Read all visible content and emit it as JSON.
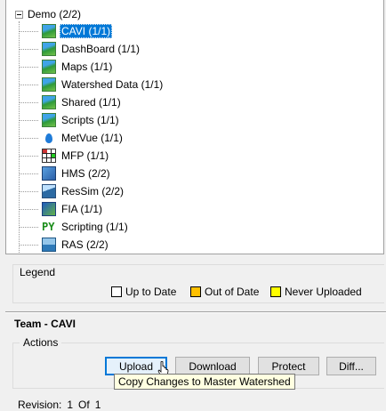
{
  "tree": {
    "root_label": "Demo (2/2)",
    "items": [
      {
        "label": "CAVI (1/1)",
        "icon": "globe-icon",
        "selected": true
      },
      {
        "label": "DashBoard (1/1)",
        "icon": "globe-icon"
      },
      {
        "label": "Maps (1/1)",
        "icon": "globe-icon"
      },
      {
        "label": "Watershed Data (1/1)",
        "icon": "globe-icon"
      },
      {
        "label": "Shared (1/1)",
        "icon": "globe-icon"
      },
      {
        "label": "Scripts (1/1)",
        "icon": "globe-icon"
      },
      {
        "label": "MetVue (1/1)",
        "icon": "water-drop-icon"
      },
      {
        "label": "MFP (1/1)",
        "icon": "grid-icon"
      },
      {
        "label": "HMS (2/2)",
        "icon": "hms-icon"
      },
      {
        "label": "ResSim (2/2)",
        "icon": "ressim-icon"
      },
      {
        "label": "FIA (1/1)",
        "icon": "fia-icon"
      },
      {
        "label": "Scripting (1/1)",
        "icon": "py-icon",
        "glyph": "PY"
      },
      {
        "label": "RAS (2/2)",
        "icon": "ras-icon"
      }
    ]
  },
  "legend": {
    "title": "Legend",
    "entries": [
      {
        "label": "Up to Date",
        "color": "#ffffff"
      },
      {
        "label": "Out of Date",
        "color": "#ffc000"
      },
      {
        "label": "Never Uploaded",
        "color": "#ffff00"
      }
    ]
  },
  "team": {
    "title": "Team - CAVI",
    "actions_title": "Actions",
    "buttons": {
      "upload": "Upload",
      "download": "Download",
      "protect": "Protect",
      "diff": "Diff..."
    },
    "tooltip": "Copy Changes to Master Watershed",
    "revision_label": "Revision:",
    "revision_value": "1",
    "revision_of": "Of",
    "revision_total": "1"
  },
  "colors": {
    "selection": "#0078d7",
    "tooltip_bg": "#ffffe1"
  }
}
